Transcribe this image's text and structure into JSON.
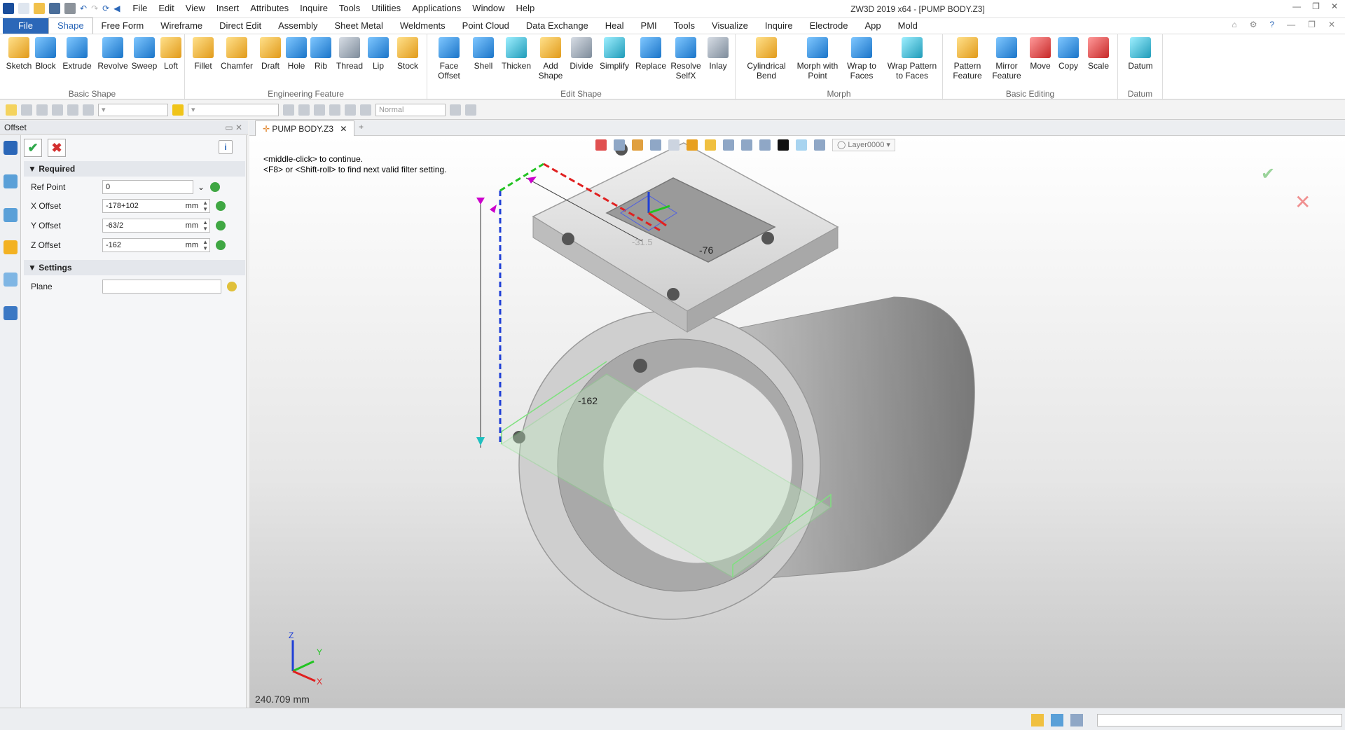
{
  "window": {
    "title": "ZW3D 2019  x64 - [PUMP BODY.Z3]"
  },
  "menu": [
    "File",
    "Edit",
    "View",
    "Insert",
    "Attributes",
    "Inquire",
    "Tools",
    "Utilities",
    "Applications",
    "Window",
    "Help"
  ],
  "ribbon_tabs": [
    "File",
    "Shape",
    "Free Form",
    "Wireframe",
    "Direct Edit",
    "Assembly",
    "Sheet Metal",
    "Weldments",
    "Point Cloud",
    "Data Exchange",
    "Heal",
    "PMI",
    "Tools",
    "Visualize",
    "Inquire",
    "Electrode",
    "App",
    "Mold"
  ],
  "ribbon": {
    "basic_shape": {
      "label": "Basic Shape",
      "buttons": [
        "Sketch",
        "Block",
        "Extrude",
        "Revolve",
        "Sweep",
        "Loft"
      ]
    },
    "engineering_feature": {
      "label": "Engineering Feature",
      "buttons": [
        "Fillet",
        "Chamfer",
        "Draft",
        "Hole",
        "Rib",
        "Thread",
        "Lip",
        "Stock"
      ]
    },
    "edit_shape": {
      "label": "Edit Shape",
      "buttons": [
        "Face Offset",
        "Shell",
        "Thicken",
        "Add Shape",
        "Divide",
        "Simplify",
        "Replace",
        "Resolve SelfX",
        "Inlay"
      ]
    },
    "morph": {
      "label": "Morph",
      "buttons": [
        "Cylindrical Bend",
        "Morph with Point",
        "Wrap to Faces",
        "Wrap Pattern to Faces"
      ]
    },
    "basic_editing": {
      "label": "Basic Editing",
      "buttons": [
        "Pattern Feature",
        "Mirror Feature",
        "Move",
        "Copy",
        "Scale"
      ]
    },
    "datum": {
      "label": "Datum",
      "buttons": [
        "Datum"
      ]
    }
  },
  "toolbar2": {
    "render_mode": "Normal",
    "layer": "Layer0000"
  },
  "panel": {
    "title": "Offset",
    "sections": {
      "required": "Required",
      "settings": "Settings"
    },
    "fields": {
      "ref_point": {
        "label": "Ref Point",
        "value": "0"
      },
      "x_offset": {
        "label": "X Offset",
        "value": "-178+102",
        "unit": "mm"
      },
      "y_offset": {
        "label": "Y Offset",
        "value": "-63/2",
        "unit": "mm"
      },
      "z_offset": {
        "label": "Z Offset",
        "value": "-162",
        "unit": "mm"
      },
      "plane": {
        "label": "Plane",
        "value": ""
      }
    }
  },
  "document": {
    "tab": "PUMP BODY.Z3"
  },
  "viewport": {
    "message_line1": "<middle-click> to continue.",
    "message_line2": "<F8> or <Shift-roll> to find next valid filter setting.",
    "dim_z": "-162",
    "dim_x": "-76",
    "dim_y": "-31.5",
    "distance": "240.709 mm",
    "axis_x": "X",
    "axis_y": "Y",
    "axis_z": "Z"
  },
  "colors": {
    "accent": "#2b67b8",
    "ok": "#2ea84a",
    "cancel": "#d32f2f",
    "z_dim": "#1f3fd6",
    "x_dim": "#e02020",
    "y_dim": "#22c322"
  }
}
